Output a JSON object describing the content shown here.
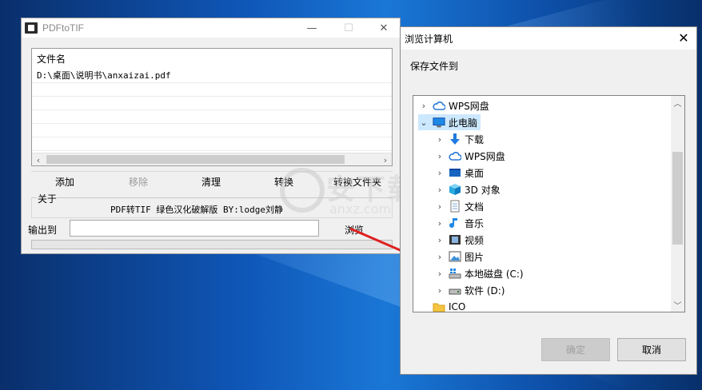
{
  "app": {
    "title": "PDFtoTIF",
    "file_list": {
      "header": "文件名",
      "rows": [
        "D:\\桌面\\说明书\\anxaizai.pdf"
      ]
    },
    "toolbar": {
      "add": "添加",
      "remove": "移除",
      "clear": "清理",
      "convert": "转换",
      "convert_folder": "转换文件夹"
    },
    "about": {
      "label": "关于",
      "credit": "PDF转TIF 绿色汉化破解版    BY:lodge刘静"
    },
    "output": {
      "label": "输出到",
      "value": "",
      "browse": "浏览"
    }
  },
  "watermark": {
    "big": "安下载",
    "small": "anxz.com"
  },
  "dialog": {
    "title": "浏览计算机",
    "prompt": "保存文件到",
    "tree": [
      {
        "label": "WPS网盘",
        "icon": "cloud-icon",
        "level": 0,
        "chevron": "›"
      },
      {
        "label": "此电脑",
        "icon": "computer-icon",
        "level": 0,
        "chevron": "⌄",
        "selected": true
      },
      {
        "label": "下载",
        "icon": "download-icon",
        "level": 1,
        "chevron": "›"
      },
      {
        "label": "WPS网盘",
        "icon": "cloud-icon",
        "level": 1,
        "chevron": "›"
      },
      {
        "label": "桌面",
        "icon": "desktop-icon",
        "level": 1,
        "chevron": "›"
      },
      {
        "label": "3D 对象",
        "icon": "3d-objects-icon",
        "level": 1,
        "chevron": "›"
      },
      {
        "label": "文档",
        "icon": "document-icon",
        "level": 1,
        "chevron": "›"
      },
      {
        "label": "音乐",
        "icon": "music-icon",
        "level": 1,
        "chevron": "›"
      },
      {
        "label": "视频",
        "icon": "video-icon",
        "level": 1,
        "chevron": "›"
      },
      {
        "label": "图片",
        "icon": "picture-icon",
        "level": 1,
        "chevron": "›"
      },
      {
        "label": "本地磁盘 (C:)",
        "icon": "system-drive-icon",
        "level": 1,
        "chevron": "›"
      },
      {
        "label": "软件 (D:)",
        "icon": "drive-icon",
        "level": 1,
        "chevron": "›"
      },
      {
        "label": "ICO",
        "icon": "folder-icon",
        "level": 0,
        "chevron": ""
      }
    ],
    "ok": "确定",
    "cancel": "取消"
  },
  "colors": {
    "selection": "#cce8ff",
    "arrow": "#e02020",
    "cloud": "#2a7ad8",
    "monitor": "#1e88e5"
  }
}
